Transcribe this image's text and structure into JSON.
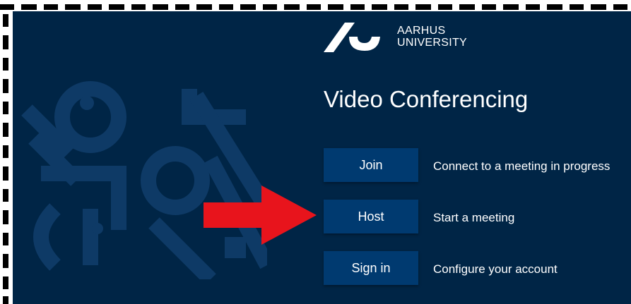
{
  "brand": {
    "line1": "AARHUS",
    "line2": "UNIVERSITY"
  },
  "title": "Video Conferencing",
  "actions": [
    {
      "label": "Join",
      "description": "Connect to a meeting in progress"
    },
    {
      "label": "Host",
      "description": "Start a meeting"
    },
    {
      "label": "Sign in",
      "description": "Configure your account"
    }
  ],
  "annotation": {
    "icon": "red-arrow-icon",
    "color": "#e8141c",
    "points_to": "Host"
  },
  "colors": {
    "background": "#002546",
    "button": "#003a70",
    "pattern": "#0e3a66",
    "text": "#ffffff"
  }
}
